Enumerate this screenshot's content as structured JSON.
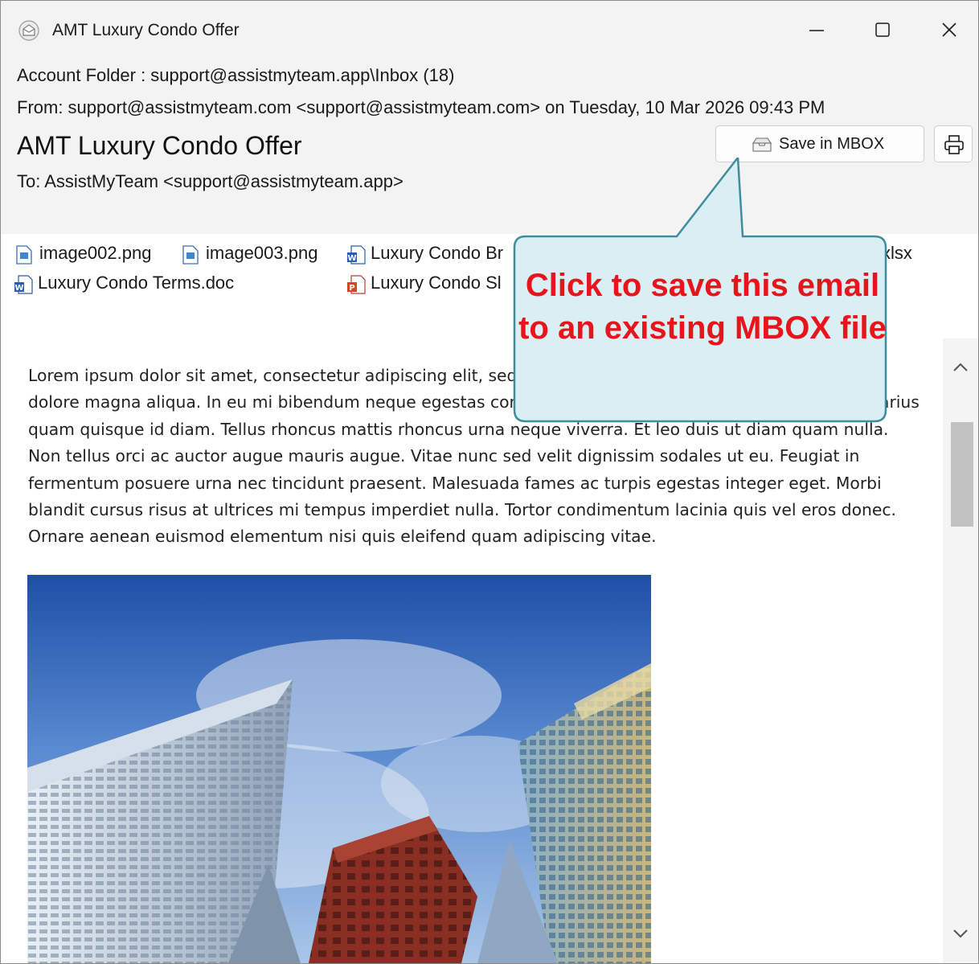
{
  "window": {
    "title": "AMT Luxury Condo Offer",
    "controls": {
      "minimize": "minimize",
      "maximize": "maximize",
      "close": "close"
    }
  },
  "header": {
    "folder": "Account Folder : support@assistmyteam.app\\Inbox (18)",
    "from": "From: support@assistmyteam.com <support@assistmyteam.com> on Tuesday, 10 Mar 2026 09:43 PM",
    "subject": "AMT Luxury Condo Offer",
    "to": "To: AssistMyTeam <support@assistmyteam.app>"
  },
  "toolbar": {
    "save_mbox_label": "Save in MBOX",
    "save_mbox_icon": "mailbox-icon",
    "print_icon": "printer-icon"
  },
  "attachments": [
    {
      "name": "image002.png",
      "icon": "image-file-icon"
    },
    {
      "name": "image003.png",
      "icon": "image-file-icon"
    },
    {
      "name": "Luxury Condo Br",
      "icon": "word-file-icon"
    },
    {
      "name": "xlsx",
      "icon": "excel-file-icon"
    },
    {
      "name": "Luxury Condo Terms.doc",
      "icon": "word-file-icon"
    },
    {
      "name": "Luxury Condo Sl",
      "icon": "powerpoint-file-icon"
    }
  ],
  "body": {
    "paragraph": "Lorem ipsum dolor sit amet, consectetur adipiscing elit, sed do eiusmod tempor incididunt ut labore et dolore magna aliqua. In eu mi bibendum neque egestas congue quisque egestas diam. Arcu risus quis varius quam quisque id diam. Tellus rhoncus mattis rhoncus urna neque viverra. Et leo duis ut diam quam nulla. Non tellus orci ac auctor augue mauris augue. Vitae nunc sed velit dignissim sodales ut eu. Feugiat in fermentum posuere urna nec tincidunt praesent. Malesuada fames ac turpis egestas integer eget. Morbi blandit cursus risus at ultrices mi tempus imperdiet nulla. Tortor condimentum lacinia quis vel eros donec. Ornare aenean euismod elementum nisi quis eleifend quam adipiscing vitae."
  },
  "callout": {
    "text": "Click to save this email to an existing MBOX file",
    "text_color": "#e8141c",
    "fill_color": "#d9eff3",
    "border_color": "#3f8d9c"
  },
  "scrollbar": {
    "position": 0.1
  }
}
